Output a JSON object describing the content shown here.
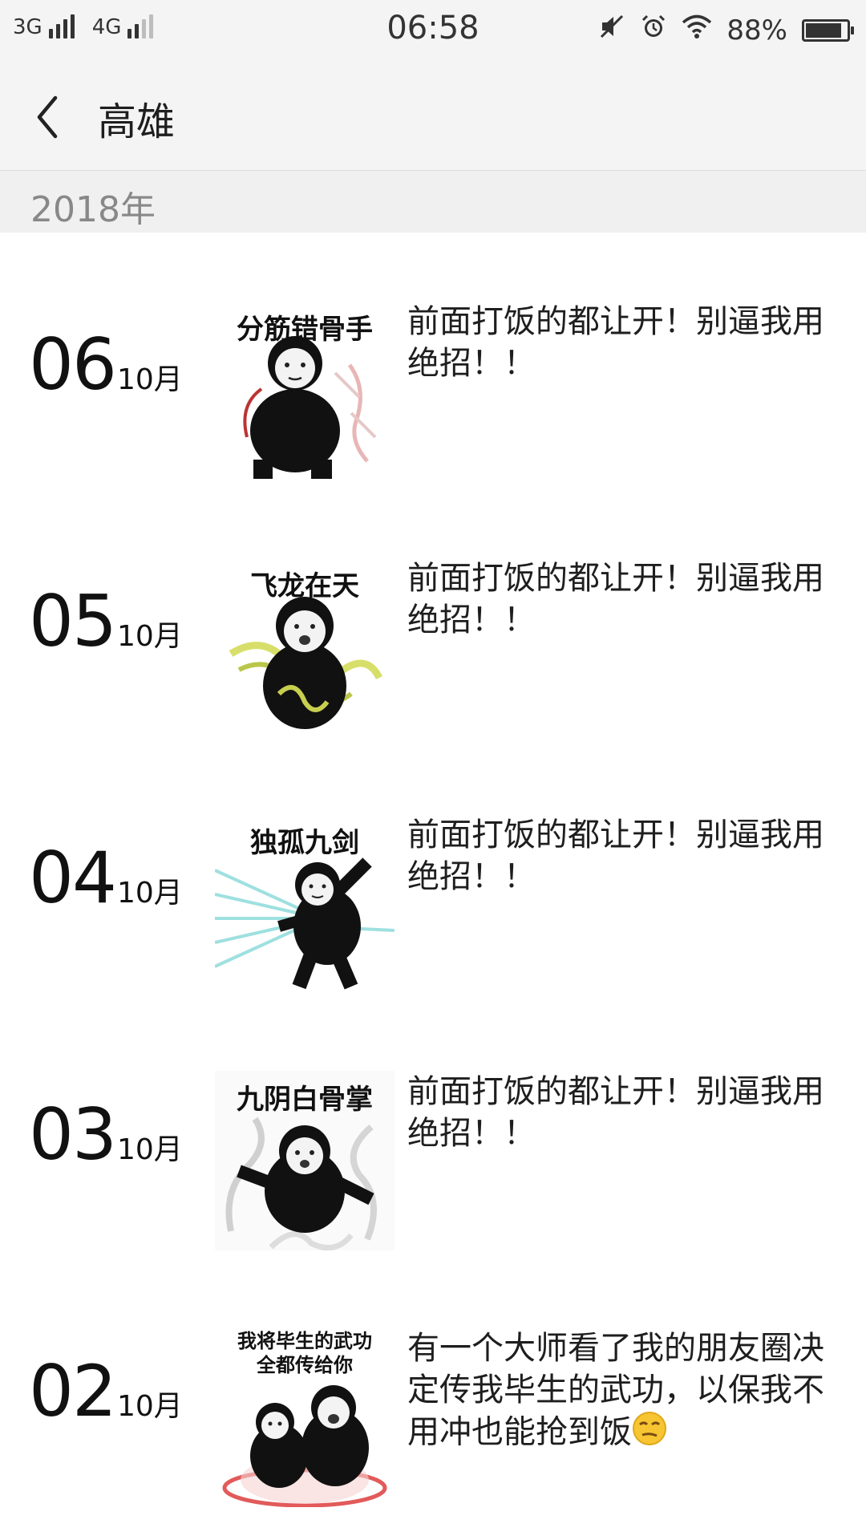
{
  "status_bar": {
    "net1": "3G",
    "net2": "4G",
    "time": "06:58",
    "battery": "88%",
    "battery_level": 0.88
  },
  "header": {
    "title": "高雄"
  },
  "year_section": {
    "label": "2018年"
  },
  "posts": [
    {
      "day": "06",
      "month": "10月",
      "image_caption": "分筋错骨手",
      "text": "前面打饭的都让开！别逼我用绝招！！"
    },
    {
      "day": "05",
      "month": "10月",
      "image_caption": "飞龙在天",
      "text": "前面打饭的都让开！别逼我用绝招！！"
    },
    {
      "day": "04",
      "month": "10月",
      "image_caption": "独孤九剑",
      "text": "前面打饭的都让开！别逼我用绝招！！"
    },
    {
      "day": "03",
      "month": "10月",
      "image_caption": "九阴白骨掌",
      "text": "前面打饭的都让开！别逼我用绝招！！"
    },
    {
      "day": "02",
      "month": "10月",
      "image_caption_line1": "我将毕生的武功",
      "image_caption_line2": "全都传给你",
      "text": "有一个大师看了我的朋友圈决定传我毕生的武功，以保我不用冲也能抢到饭"
    }
  ],
  "icons": {
    "back": "chevron-left-icon",
    "mute": "mute-icon",
    "alarm": "alarm-icon",
    "wifi": "wifi-icon",
    "battery": "battery-icon",
    "emoji": "smirk-emoji-icon"
  }
}
